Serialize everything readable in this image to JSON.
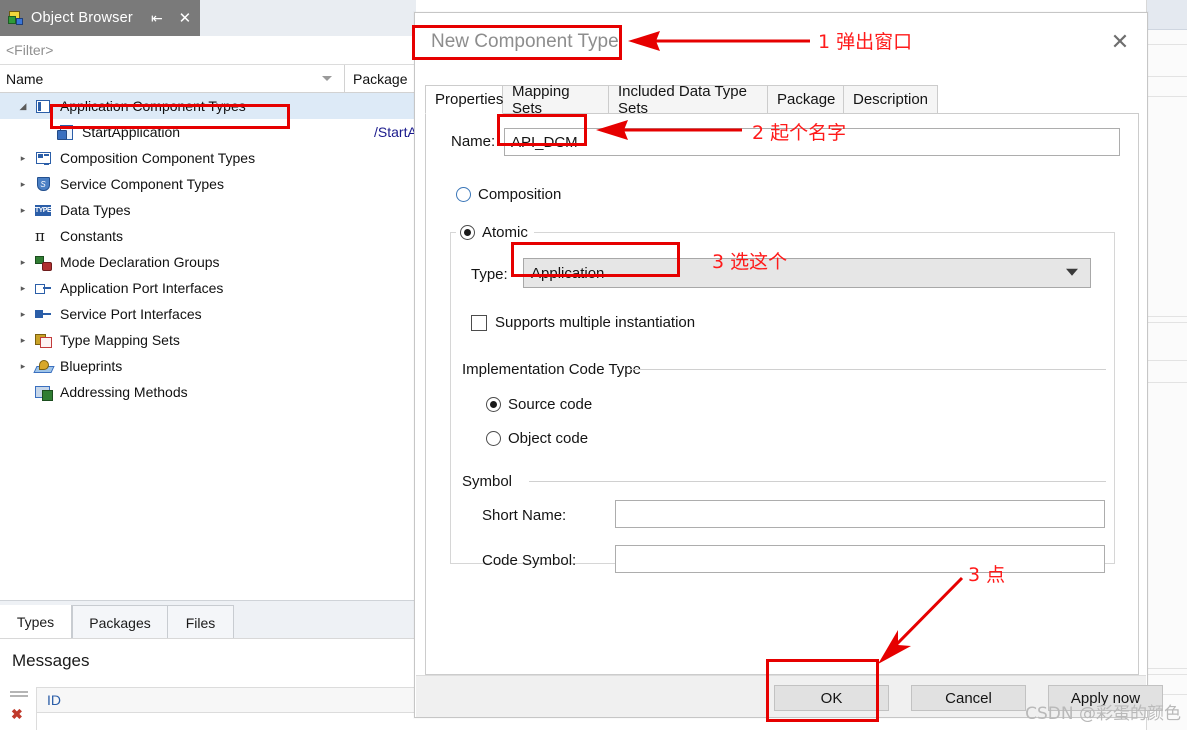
{
  "object_browser": {
    "tab_title": "Object Browser",
    "icon": "application-browser-icon",
    "pin_label": "⇥",
    "close_label": "✕",
    "filter_placeholder": "<Filter>",
    "columns": {
      "name": "Name",
      "package": "Package"
    },
    "tree": [
      {
        "label": "Application Component Types",
        "icon": "application-component-type-icon",
        "twisty": "open",
        "indent": 0,
        "selected": true,
        "package": ""
      },
      {
        "label": "StartApplication",
        "icon": "start-application-icon",
        "twisty": "none",
        "indent": 1,
        "selected": false,
        "package": "/StartAp"
      },
      {
        "label": "Composition Component Types",
        "icon": "composition-component-type-icon",
        "twisty": "closed",
        "indent": 0,
        "selected": false,
        "package": ""
      },
      {
        "label": "Service Component Types",
        "icon": "service-component-type-icon",
        "twisty": "closed",
        "indent": 0,
        "selected": false,
        "package": ""
      },
      {
        "label": "Data Types",
        "icon": "data-type-icon",
        "twisty": "closed",
        "indent": 0,
        "selected": false,
        "package": ""
      },
      {
        "label": "Constants",
        "icon": "constant-pi-icon",
        "twisty": "none",
        "indent": 0,
        "selected": false,
        "package": ""
      },
      {
        "label": "Mode Declaration Groups",
        "icon": "mode-declaration-group-icon",
        "twisty": "closed",
        "indent": 0,
        "selected": false,
        "package": ""
      },
      {
        "label": "Application Port Interfaces",
        "icon": "application-port-interface-icon",
        "twisty": "closed",
        "indent": 0,
        "selected": false,
        "package": ""
      },
      {
        "label": "Service Port Interfaces",
        "icon": "service-port-interface-icon",
        "twisty": "closed",
        "indent": 0,
        "selected": false,
        "package": ""
      },
      {
        "label": "Type Mapping Sets",
        "icon": "type-mapping-set-icon",
        "twisty": "closed",
        "indent": 0,
        "selected": false,
        "package": ""
      },
      {
        "label": "Blueprints",
        "icon": "blueprint-icon",
        "twisty": "closed",
        "indent": 0,
        "selected": false,
        "package": ""
      },
      {
        "label": "Addressing Methods",
        "icon": "addressing-method-icon",
        "twisty": "none",
        "indent": 0,
        "selected": false,
        "package": ""
      }
    ],
    "bottom_tabs": [
      {
        "label": "Types",
        "active": true
      },
      {
        "label": "Packages",
        "active": false
      },
      {
        "label": "Files",
        "active": false
      }
    ]
  },
  "messages": {
    "title": "Messages",
    "column_id": "ID",
    "gutter_error_icon": "error-x-icon",
    "gutter_filter_icon": "filter-lines-icon"
  },
  "dialog": {
    "title": "New Component Type",
    "close_label": "✕",
    "tabs": [
      {
        "label": "Properties",
        "active": true
      },
      {
        "label": "Mapping Sets",
        "active": false
      },
      {
        "label": "Included Data Type Sets",
        "active": false
      },
      {
        "label": "Package",
        "active": false
      },
      {
        "label": "Description",
        "active": false
      }
    ],
    "name_label": "Name:",
    "name_value": "API_DCM",
    "name_placeholder": "",
    "composition_label": "Composition",
    "composition_selected": false,
    "atomic_label": "Atomic",
    "atomic_selected": true,
    "type_label": "Type:",
    "type_value": "Application",
    "type_caret_icon": "chevron-down-icon",
    "supports_multiple_label": "Supports multiple instantiation",
    "supports_multiple_checked": false,
    "impl_group_label": "Implementation Code Type",
    "source_code_label": "Source code",
    "source_code_selected": true,
    "object_code_label": "Object code",
    "object_code_selected": false,
    "symbol_group_label": "Symbol",
    "short_name_label": "Short Name:",
    "short_name_value": "",
    "code_symbol_label": "Code Symbol:",
    "code_symbol_value": "",
    "buttons": {
      "ok": "OK",
      "cancel": "Cancel",
      "apply": "Apply now"
    }
  },
  "annotations": {
    "color": "#ff1a1a",
    "steps": [
      {
        "text": "1  弹出窗口"
      },
      {
        "text": "2  起个名字"
      },
      {
        "text": "3  选这个"
      },
      {
        "text": "3  点"
      }
    ]
  },
  "watermark": "CSDN @彩蛋的颜色"
}
